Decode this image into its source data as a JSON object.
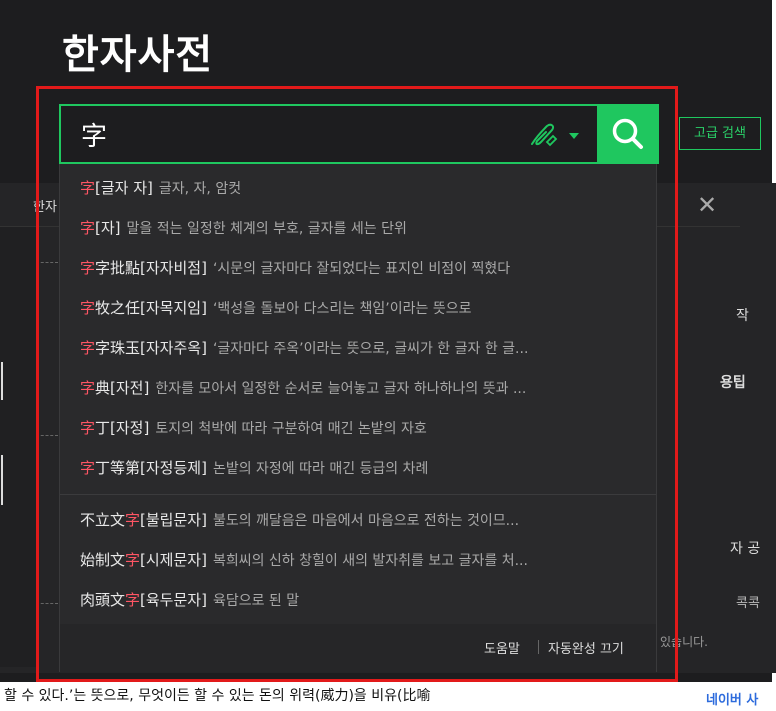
{
  "page": {
    "title": "한자사전"
  },
  "advanced_search": {
    "label": "고급 검색"
  },
  "search": {
    "query": "字"
  },
  "background": {
    "tab_label": "한자",
    "close_glyph": "✕",
    "side_1": "작",
    "side_2": "용팁",
    "side_3": "자 공",
    "side_4": "콕콕",
    "note": "있습니다."
  },
  "suggestions": [
    {
      "hl_pre": "字",
      "head_post": "",
      "reading": "[글자 자]",
      "desc": "글자, 자, 암컷"
    },
    {
      "hl_pre": "字",
      "head_post": "",
      "reading": "[자]",
      "desc": "말을 적는 일정한 체계의 부호, 글자를 세는 단위"
    },
    {
      "hl_pre": "字",
      "head_post": "字批點",
      "reading": "[자자비점]",
      "desc": "‘시문의 글자마다 잘되었다는 표지인 비점이 찍혔다"
    },
    {
      "hl_pre": "字",
      "head_post": "牧之任",
      "reading": "[자목지임]",
      "desc": "‘백성을 돌보아 다스리는 책임’이라는 뜻으로"
    },
    {
      "hl_pre": "字",
      "head_post": "字珠玉",
      "reading": "[자자주옥]",
      "desc": "‘글자마다 주옥’이라는 뜻으로, 글씨가 한 글자 한 글..."
    },
    {
      "hl_pre": "字",
      "head_post": "典",
      "reading": "[자전]",
      "desc": "한자를 모아서 일정한 순서로 늘어놓고 글자 하나하나의 뜻과 ..."
    },
    {
      "hl_pre": "字",
      "head_post": "丁",
      "reading": "[자정]",
      "desc": "토지의 척박에 따라 구분하여 매긴 논밭의 자호"
    },
    {
      "hl_pre": "字",
      "head_post": "丁等第",
      "reading": "[자정등제]",
      "desc": "논밭의 자정에 따라 매긴 등급의 차례"
    }
  ],
  "suggestions_suffix": [
    {
      "head_pre": "不立文",
      "hl": "字",
      "reading": "[불립문자]",
      "desc": "불도의 깨달음은 마음에서 마음으로 전하는 것이므..."
    },
    {
      "head_pre": "始制文",
      "hl": "字",
      "reading": "[시제문자]",
      "desc": "복희씨의 신하 창힐이 새의 발자취를 보고 글자를 처..."
    },
    {
      "head_pre": "肉頭文",
      "hl": "字",
      "reading": "[육두문자]",
      "desc": "육담으로 된 말"
    }
  ],
  "footer": {
    "help": "도움말",
    "autocomplete_off": "자동완성 끄기"
  },
  "bottom": {
    "text": "할 수 있다.’는 뜻으로, 무엇이든 할 수 있는 돈의 위력(威力)을 비유(比喻",
    "right": "네이버 사"
  },
  "colors": {
    "accent": "#1fc75f",
    "highlight": "#ff5564",
    "frame": "#e21a1a"
  }
}
